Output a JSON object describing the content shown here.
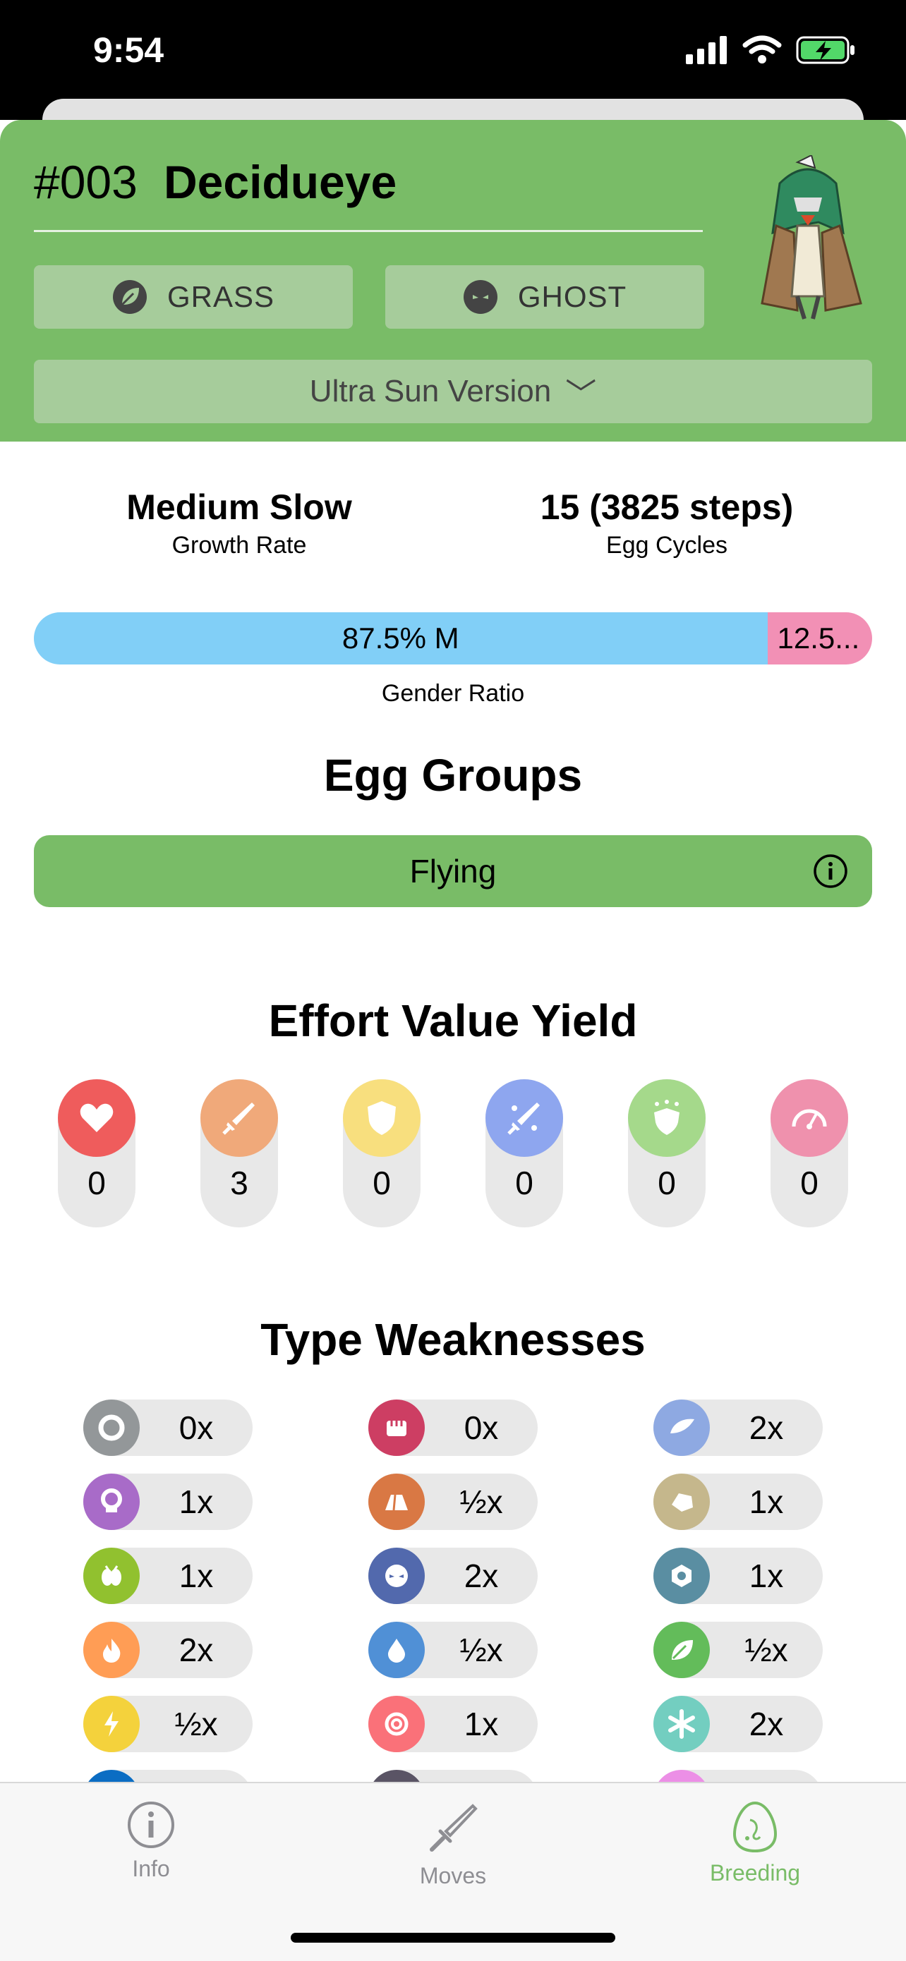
{
  "status": {
    "time": "9:54"
  },
  "pokemon": {
    "number": "#003",
    "name": "Decidueye"
  },
  "types": [
    {
      "label": "GRASS",
      "icon": "leaf-icon"
    },
    {
      "label": "GHOST",
      "icon": "ghost-icon"
    }
  ],
  "version": {
    "label": "Ultra Sun Version",
    "chevron": "﹀"
  },
  "growth": {
    "value": "Medium Slow",
    "label": "Growth Rate"
  },
  "egg_cycles": {
    "value": "15 (3825 steps)",
    "label": "Egg Cycles"
  },
  "gender": {
    "male_text": "87.5% M",
    "female_text": "12.5...",
    "male_fraction": 0.875,
    "label": "Gender Ratio"
  },
  "egg_groups": {
    "title": "Egg Groups",
    "items": [
      "Flying"
    ]
  },
  "ev_yield": {
    "title": "Effort Value Yield",
    "stats": [
      {
        "icon": "heart-icon",
        "value": "0",
        "color": "#ef5c5c"
      },
      {
        "icon": "sword-icon",
        "value": "3",
        "color": "#f0a97a"
      },
      {
        "icon": "shield-icon",
        "value": "0",
        "color": "#f8df7e"
      },
      {
        "icon": "sparkle-sword-icon",
        "value": "0",
        "color": "#8ea6ef"
      },
      {
        "icon": "star-shield-icon",
        "value": "0",
        "color": "#a5d98b"
      },
      {
        "icon": "speedometer-icon",
        "value": "0",
        "color": "#ef91ad"
      }
    ]
  },
  "weaknesses": {
    "title": "Type Weaknesses",
    "items": [
      {
        "type": "normal",
        "value": "0x",
        "color": "#939799"
      },
      {
        "type": "fighting",
        "value": "0x",
        "color": "#cd3e63"
      },
      {
        "type": "flying",
        "value": "2x",
        "color": "#8ea9e2"
      },
      {
        "type": "poison",
        "value": "1x",
        "color": "#a86bc8"
      },
      {
        "type": "ground",
        "value": "½x",
        "color": "#d97844"
      },
      {
        "type": "rock",
        "value": "1x",
        "color": "#c5b78c"
      },
      {
        "type": "bug",
        "value": "1x",
        "color": "#91c12f"
      },
      {
        "type": "ghost",
        "value": "2x",
        "color": "#5269ad"
      },
      {
        "type": "steel",
        "value": "1x",
        "color": "#5a8ea2"
      },
      {
        "type": "fire",
        "value": "2x",
        "color": "#ff9d55"
      },
      {
        "type": "water",
        "value": "½x",
        "color": "#5090d6"
      },
      {
        "type": "grass",
        "value": "½x",
        "color": "#63bc5a"
      },
      {
        "type": "electric",
        "value": "½x",
        "color": "#f4d23c"
      },
      {
        "type": "psychic",
        "value": "1x",
        "color": "#fa7179"
      },
      {
        "type": "ice",
        "value": "2x",
        "color": "#73cec0"
      },
      {
        "type": "dragon",
        "value": "",
        "color": "#0b6dc3"
      },
      {
        "type": "dark",
        "value": "",
        "color": "#5a5465"
      },
      {
        "type": "fairy",
        "value": "",
        "color": "#ec8fe6"
      }
    ]
  },
  "tabs": [
    {
      "label": "Info",
      "icon": "info-icon",
      "active": false
    },
    {
      "label": "Moves",
      "icon": "sword-icon",
      "active": false
    },
    {
      "label": "Breeding",
      "icon": "egg-icon",
      "active": true
    }
  ]
}
